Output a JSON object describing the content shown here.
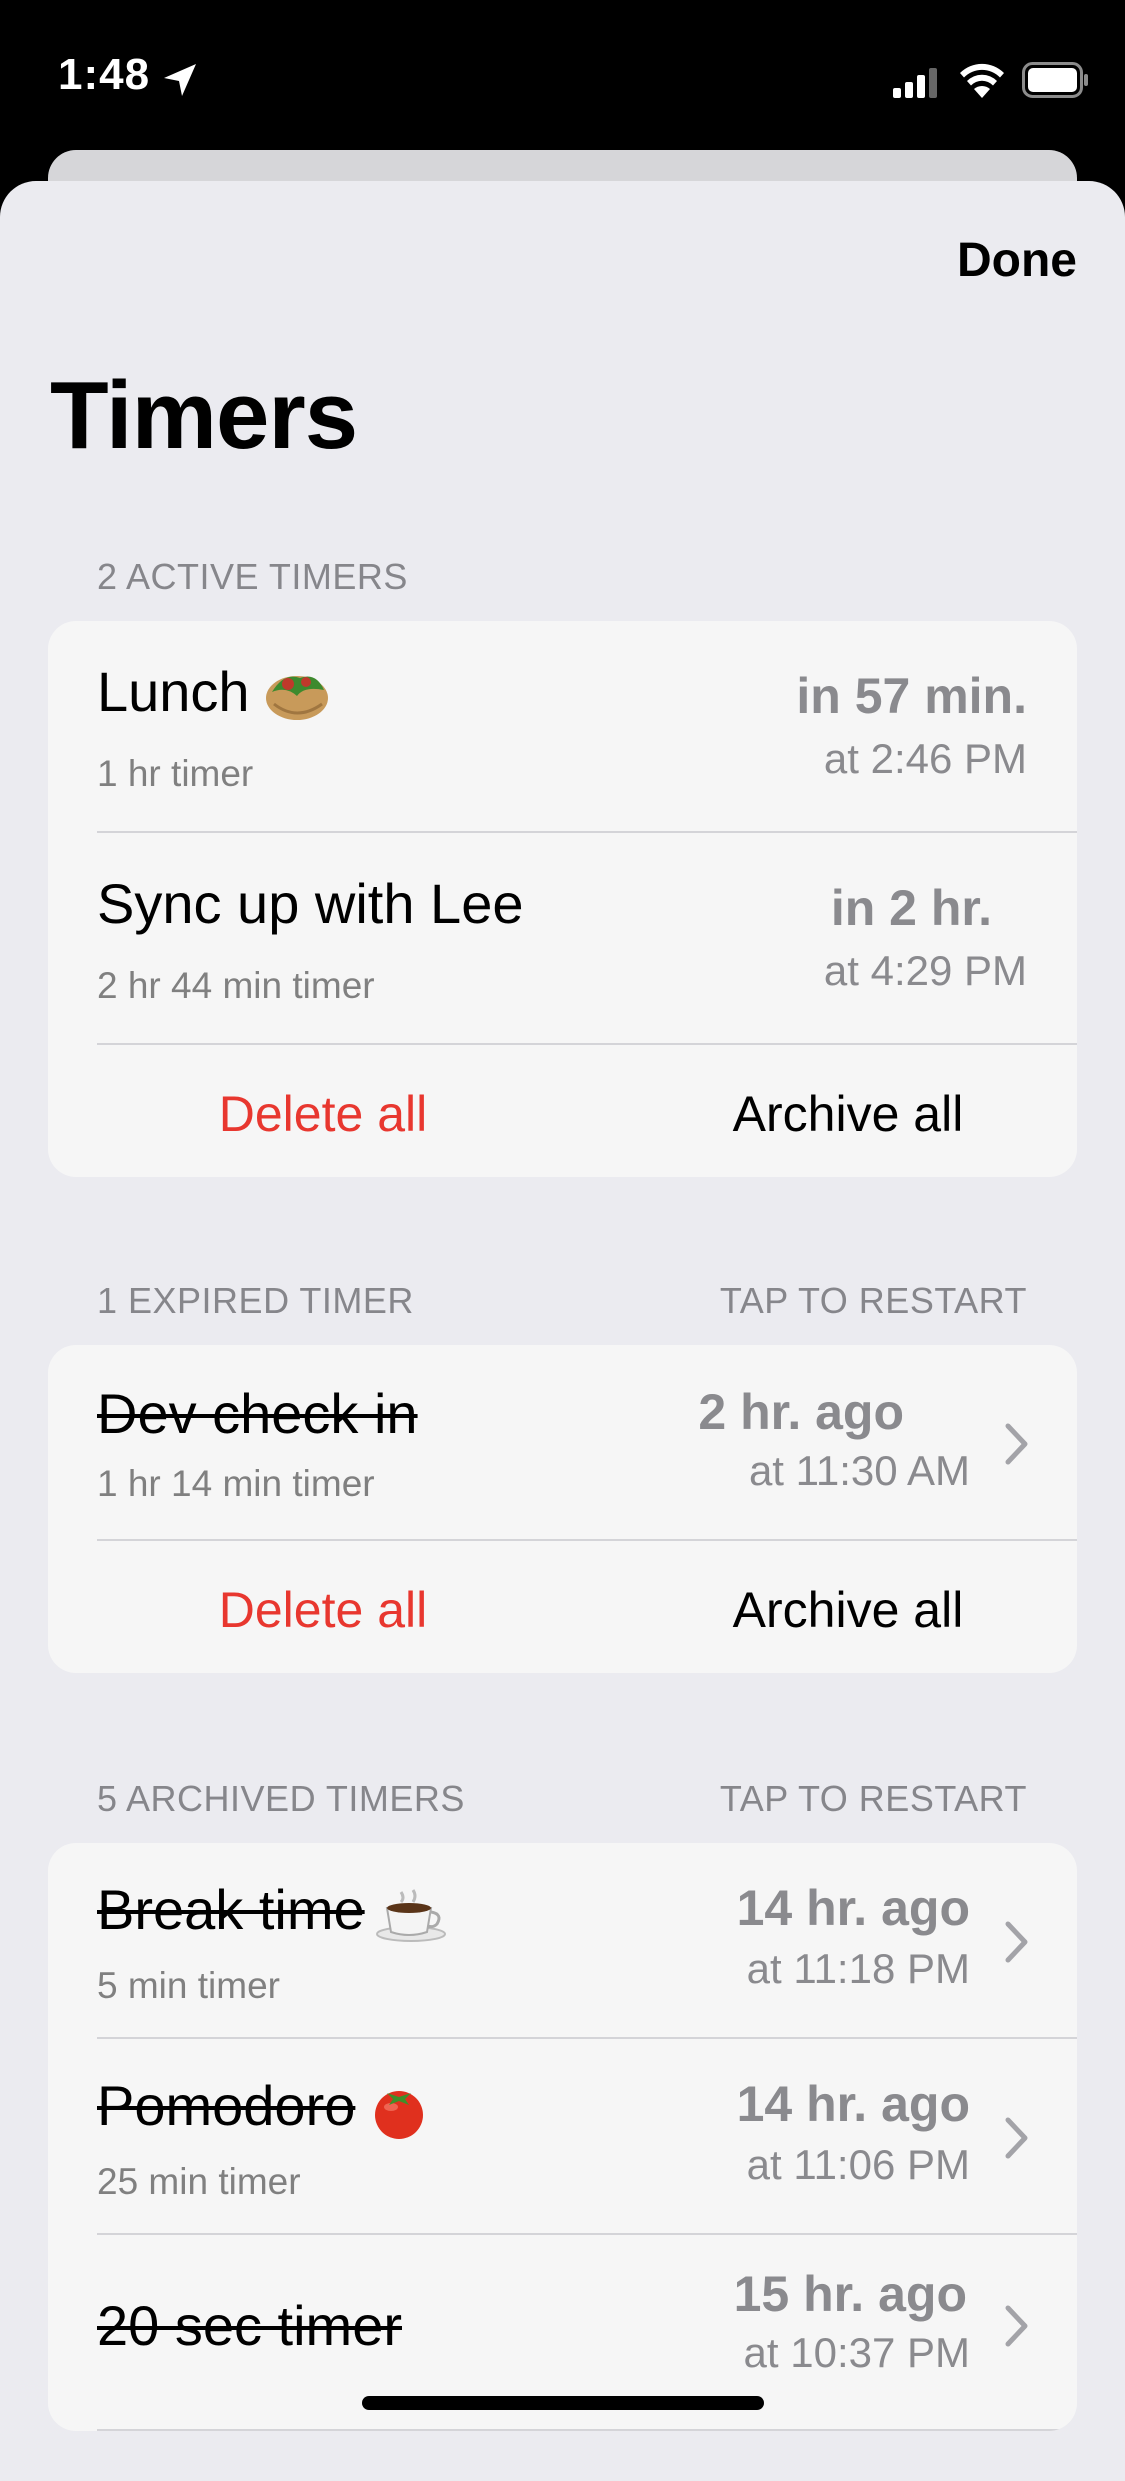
{
  "status_bar": {
    "time": "1:48"
  },
  "header": {
    "done_label": "Done",
    "title": "Timers"
  },
  "active": {
    "header": "2 ACTIVE TIMERS",
    "rows": [
      {
        "title": "Lunch",
        "emoji": "burrito",
        "subtitle": "1 hr timer",
        "relative": "in 57 min.",
        "absolute": "at 2:46 PM"
      },
      {
        "title": "Sync up with Lee",
        "subtitle": "2 hr 44 min timer",
        "relative": "in 2 hr.",
        "absolute": "at 4:29 PM"
      }
    ],
    "delete_label": "Delete all",
    "archive_label": "Archive all"
  },
  "expired": {
    "header": "1 EXPIRED TIMER",
    "hint": "TAP TO RESTART",
    "rows": [
      {
        "title": "Dev check in",
        "subtitle": "1 hr 14 min timer",
        "relative": "2 hr. ago",
        "absolute": "at 11:30 AM"
      }
    ],
    "delete_label": "Delete all",
    "archive_label": "Archive all"
  },
  "archived": {
    "header": "5 ARCHIVED TIMERS",
    "hint": "TAP TO RESTART",
    "rows": [
      {
        "title": "Break time",
        "emoji": "coffee",
        "subtitle": "5 min timer",
        "relative": "14 hr. ago",
        "absolute": "at 11:18 PM"
      },
      {
        "title": "Pomodoro",
        "emoji": "tomato",
        "subtitle": "25 min timer",
        "relative": "14 hr. ago",
        "absolute": "at 11:06 PM"
      },
      {
        "title": "20 sec timer",
        "relative": "15 hr. ago",
        "absolute": "at 10:37 PM"
      }
    ]
  },
  "colors": {
    "destructive": "#e8372f",
    "secondary_text": "#8a8a8e",
    "sheet_bg": "#ebebf0",
    "card_bg": "#f6f6f6"
  }
}
